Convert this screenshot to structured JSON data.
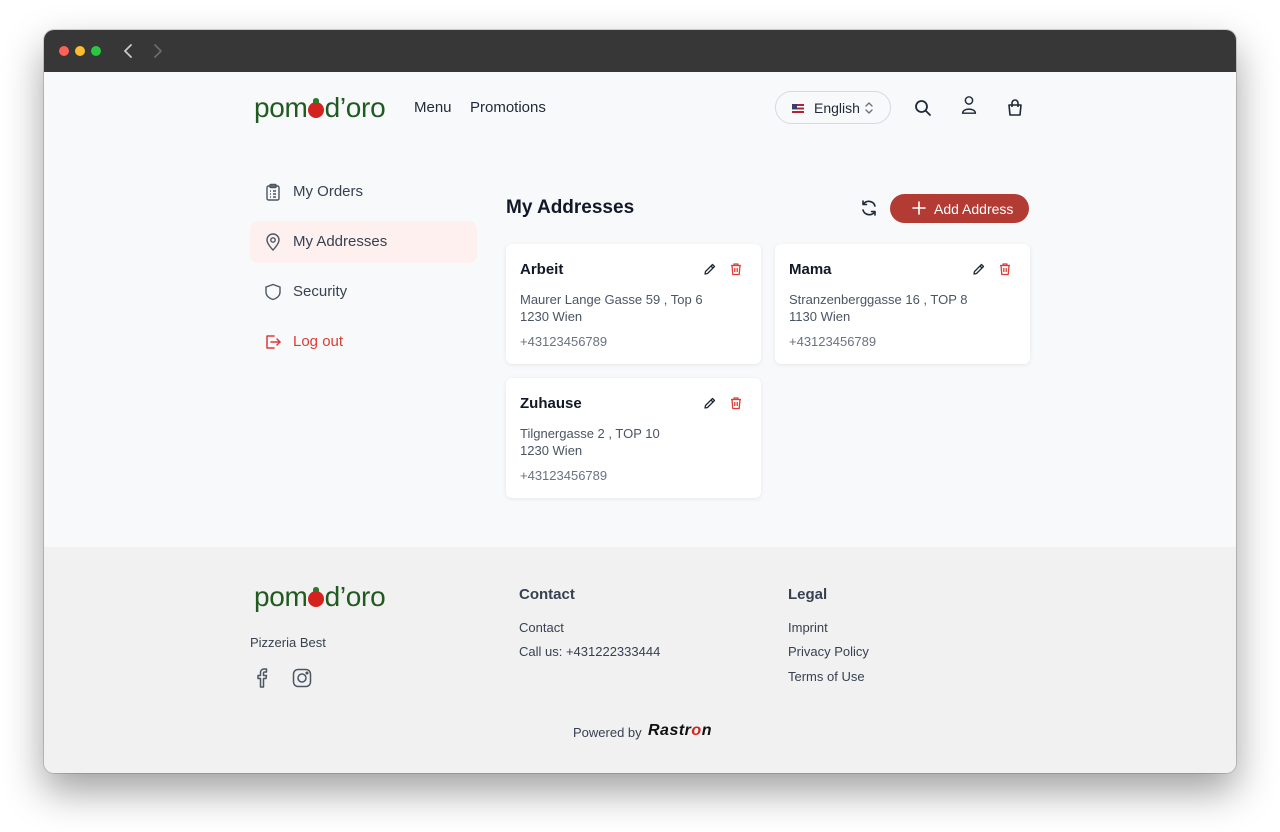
{
  "header": {
    "logo_prefix": "pom",
    "logo_suffix": "d’oro",
    "nav": [
      "Menu",
      "Promotions"
    ],
    "language": "English"
  },
  "sidebar": {
    "items": [
      {
        "label": "My Orders",
        "icon": "clipboard-icon",
        "active": false
      },
      {
        "label": "My Addresses",
        "icon": "map-pin-icon",
        "active": true
      },
      {
        "label": "Security",
        "icon": "shield-icon",
        "active": false
      },
      {
        "label": "Log out",
        "icon": "logout-icon",
        "active": false
      }
    ]
  },
  "main": {
    "title": "My Addresses",
    "add_button": "Add Address",
    "addresses": [
      {
        "name": "Arbeit",
        "line1": "Maurer Lange Gasse 59 , Top 6",
        "line2": "1230 Wien",
        "phone": "+43123456789"
      },
      {
        "name": "Mama",
        "line1": "Stranzenberggasse 16 , TOP 8",
        "line2": "1130 Wien",
        "phone": "+43123456789"
      },
      {
        "name": "Zuhause",
        "line1": "Tilgnergasse 2 , TOP 10",
        "line2": "1230 Wien",
        "phone": "+43123456789"
      }
    ]
  },
  "footer": {
    "tagline": "Pizzeria Best",
    "contact_heading": "Contact",
    "contact_links": [
      "Contact",
      "Call us: +431222333444"
    ],
    "legal_heading": "Legal",
    "legal_links": [
      "Imprint",
      "Privacy Policy",
      "Terms of Use"
    ],
    "powered_by": "Powered by",
    "brand_prefix": "Rastr",
    "brand_o": "o",
    "brand_suffix": "n"
  },
  "colors": {
    "accent": "#b23b33",
    "danger": "#dc3b36",
    "logo_green": "#1f5a1f",
    "active_bg": "#fdf0ef"
  }
}
